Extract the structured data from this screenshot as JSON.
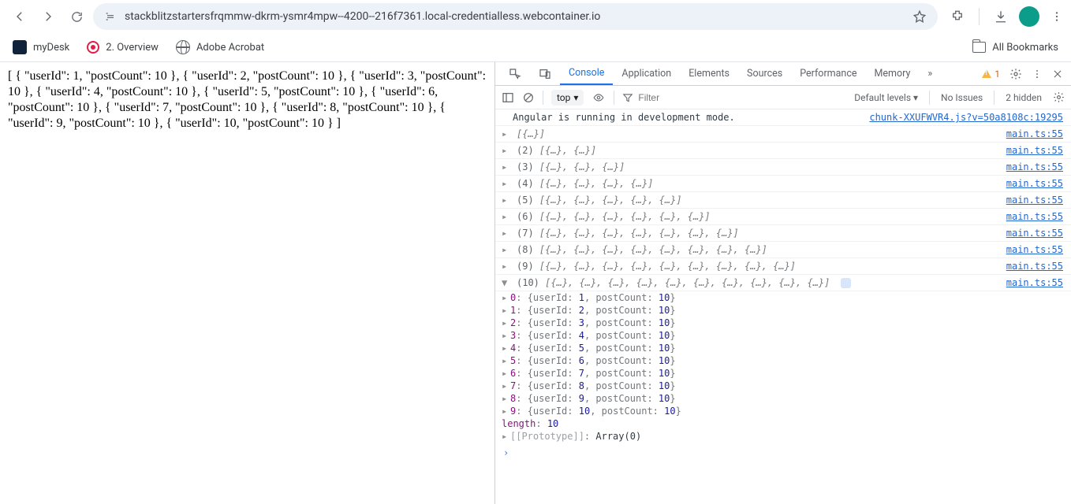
{
  "browser": {
    "url": "stackblitzstartersfrqmmw-dkrm-ysmr4mpw--4200--216f7361.local-credentialless.webcontainer.io",
    "allBookmarks": "All Bookmarks"
  },
  "bookmarks": [
    {
      "label": "myDesk"
    },
    {
      "label": "2. Overview"
    },
    {
      "label": "Adobe Acrobat"
    }
  ],
  "pageContent": "[ { \"userId\": 1, \"postCount\": 10 }, { \"userId\": 2, \"postCount\": 10 }, { \"userId\": 3, \"postCount\": 10 }, { \"userId\": 4, \"postCount\": 10 }, { \"userId\": 5, \"postCount\": 10 }, { \"userId\": 6, \"postCount\": 10 }, { \"userId\": 7, \"postCount\": 10 }, { \"userId\": 8, \"postCount\": 10 }, { \"userId\": 9, \"postCount\": 10 }, { \"userId\": 10, \"postCount\": 10 } ]",
  "devtools": {
    "tabs": {
      "console": "Console",
      "application": "Application",
      "elements": "Elements",
      "sources": "Sources",
      "performance": "Performance",
      "memory": "Memory",
      "more": "»"
    },
    "warningsCount": "1",
    "row2": {
      "context": "top",
      "filterPlaceholder": "Filter",
      "levels": "Default levels",
      "noIssues": "No Issues",
      "hidden": "2 hidden"
    },
    "angularMsg": "Angular is running in development mode.",
    "angularSrc": "chunk-XXUFWVR4.js?v=50a8108c:19295",
    "mainSrc": "main.ts:55",
    "arrays": [
      {
        "count": "",
        "body": "[{…}]"
      },
      {
        "count": "(2)",
        "body": "[{…}, {…}]"
      },
      {
        "count": "(3)",
        "body": "[{…}, {…}, {…}]"
      },
      {
        "count": "(4)",
        "body": "[{…}, {…}, {…}, {…}]"
      },
      {
        "count": "(5)",
        "body": "[{…}, {…}, {…}, {…}, {…}]"
      },
      {
        "count": "(6)",
        "body": "[{…}, {…}, {…}, {…}, {…}, {…}]"
      },
      {
        "count": "(7)",
        "body": "[{…}, {…}, {…}, {…}, {…}, {…}, {…}]"
      },
      {
        "count": "(8)",
        "body": "[{…}, {…}, {…}, {…}, {…}, {…}, {…}, {…}]"
      },
      {
        "count": "(9)",
        "body": "[{…}, {…}, {…}, {…}, {…}, {…}, {…}, {…}, {…}]"
      }
    ],
    "expanded": {
      "count": "(10)",
      "body": "[{…}, {…}, {…}, {…}, {…}, {…}, {…}, {…}, {…}, {…}]",
      "items": [
        {
          "idx": "0",
          "userId": "1",
          "postCount": "10"
        },
        {
          "idx": "1",
          "userId": "2",
          "postCount": "10"
        },
        {
          "idx": "2",
          "userId": "3",
          "postCount": "10"
        },
        {
          "idx": "3",
          "userId": "4",
          "postCount": "10"
        },
        {
          "idx": "4",
          "userId": "5",
          "postCount": "10"
        },
        {
          "idx": "5",
          "userId": "6",
          "postCount": "10"
        },
        {
          "idx": "6",
          "userId": "7",
          "postCount": "10"
        },
        {
          "idx": "7",
          "userId": "8",
          "postCount": "10"
        },
        {
          "idx": "8",
          "userId": "9",
          "postCount": "10"
        },
        {
          "idx": "9",
          "userId": "10",
          "postCount": "10"
        }
      ],
      "lengthLabel": "length",
      "lengthValue": "10",
      "protoLabel": "[[Prototype]]",
      "protoValue": "Array(0)"
    }
  }
}
